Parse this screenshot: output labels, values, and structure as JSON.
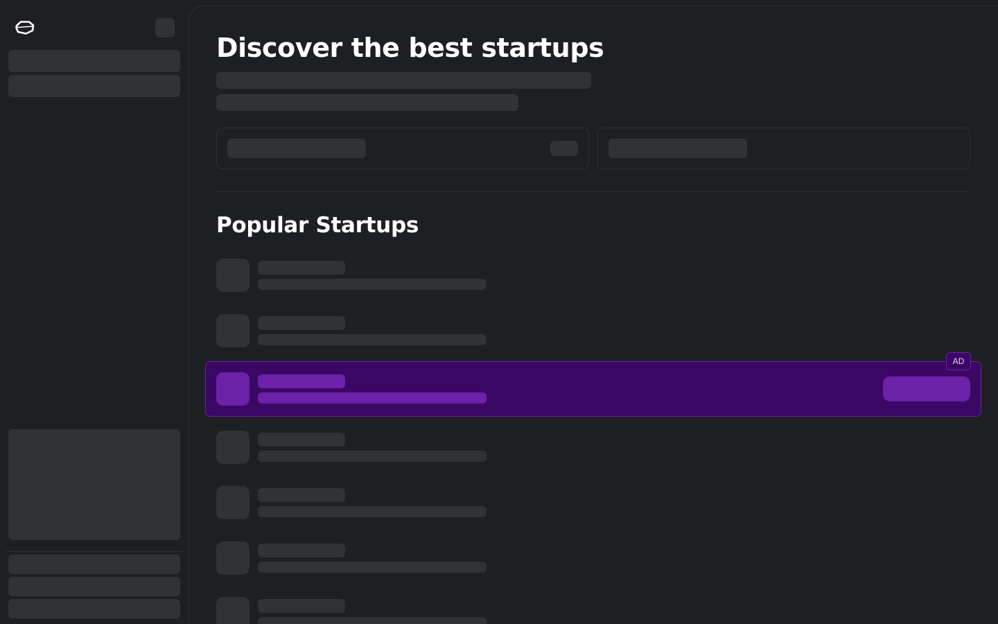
{
  "page": {
    "title": "Discover the best startups",
    "section_title": "Popular Startups"
  },
  "ad": {
    "badge": "AD"
  },
  "colors": {
    "background": "#1e1f23",
    "skeleton": "#313236",
    "border": "#2e2f33",
    "ad_background": "#3b0764",
    "ad_accent": "#6b21a8",
    "text": "#ffffff"
  },
  "icons": {
    "logo": "logo-icon"
  }
}
